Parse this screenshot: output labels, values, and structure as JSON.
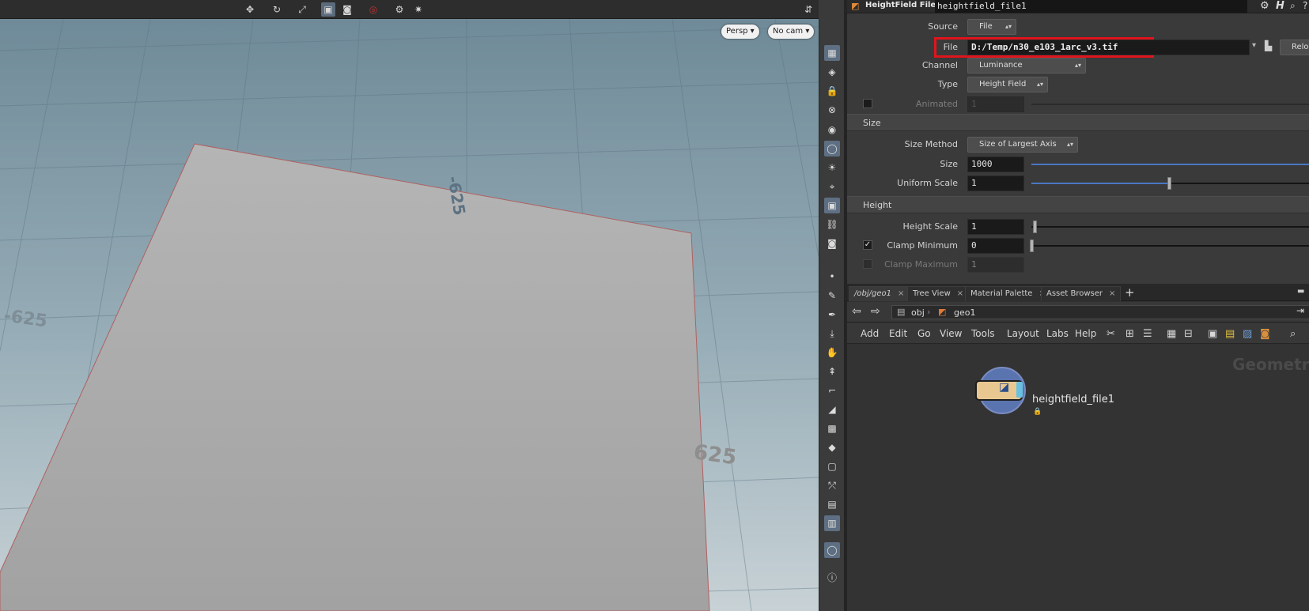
{
  "viewport": {
    "camera_view": "Persp",
    "camera_name": "No cam",
    "grid_labels": {
      "top": "-625",
      "left": "-625",
      "right": "625"
    }
  },
  "params": {
    "node_type_label": "HeightField File",
    "node_name": "heightfield_file1",
    "source_label": "Source",
    "source_value": "File",
    "file_label": "File",
    "file_value": "D:/Temp/n30_e103_1arc_v3.tif",
    "reload_label": "Reload File",
    "channel_label": "Channel",
    "channel_value": "Luminance",
    "type_label": "Type",
    "type_value": "Height Field",
    "animated_label": "Animated",
    "animated_value": "1",
    "size_section": "Size",
    "size_method_label": "Size Method",
    "size_method_value": "Size of Largest Axis",
    "size_label": "Size",
    "size_value": "1000",
    "uniform_scale_label": "Uniform Scale",
    "uniform_scale_value": "1",
    "height_section": "Height",
    "height_scale_label": "Height Scale",
    "height_scale_value": "1",
    "clamp_min_label": "Clamp Minimum",
    "clamp_min_value": "0",
    "clamp_max_label": "Clamp Maximum",
    "clamp_max_value": "1"
  },
  "network": {
    "tabs": [
      {
        "label": "/obj/geo1"
      },
      {
        "label": "Tree View"
      },
      {
        "label": "Material Palette"
      },
      {
        "label": "Asset Browser"
      }
    ],
    "path": {
      "root": "obj",
      "current": "geo1"
    },
    "menus": [
      "Add",
      "Edit",
      "Go",
      "View",
      "Tools",
      "Layout",
      "Labs",
      "Help"
    ],
    "context_label": "Geometry",
    "node_label": "heightfield_file1"
  },
  "colors": {
    "highlight": "#e0141c",
    "slider_blue": "#4a78c2",
    "selection": "#5e6f83"
  }
}
